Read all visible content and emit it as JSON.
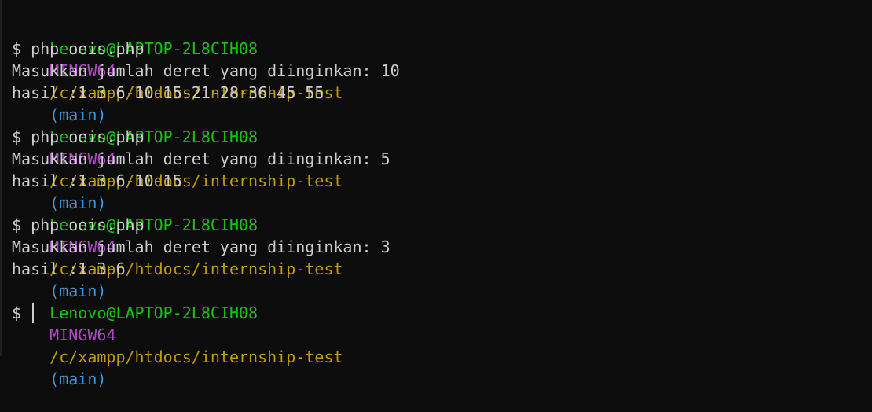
{
  "colors": {
    "background": "#0c0c0c",
    "text": "#cccccc",
    "user_host": "#16c60c",
    "msystem": "#b148c6",
    "path": "#c19c00",
    "branch": "#3a96dd",
    "cursor": "#cccccc"
  },
  "prompt": {
    "user_host": "Lenovo@LAPTOP-2L8CIH08",
    "msystem": "MINGW64",
    "path": "/c/xampp/htdocs/internship-test",
    "branch": "(main)",
    "symbol": "$"
  },
  "sessions": [
    {
      "command": "php oeis.php",
      "prompt_text": "Masukkan jumlah deret yang diinginkan:",
      "input_value": "10",
      "result": "hasil :1-3-6-10-15-21-28-36-45-55"
    },
    {
      "command": "php oeis.php",
      "prompt_text": "Masukkan jumlah deret yang diinginkan:",
      "input_value": "5",
      "result": "hasil :1-3-6-10-15"
    },
    {
      "command": "php oeis.php",
      "prompt_text": "Masukkan jumlah deret yang diinginkan:",
      "input_value": "3",
      "result": "hasil :1-3-6"
    }
  ]
}
